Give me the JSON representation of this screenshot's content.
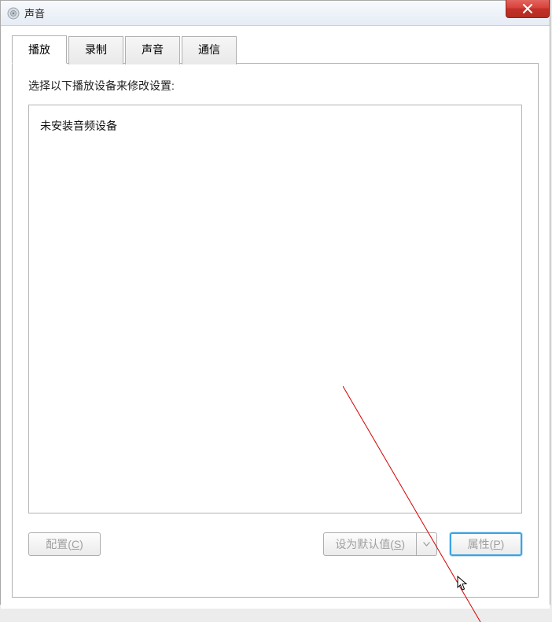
{
  "window": {
    "title": "声音"
  },
  "tabs": [
    {
      "label": "播放",
      "active": true
    },
    {
      "label": "录制",
      "active": false
    },
    {
      "label": "声音",
      "active": false
    },
    {
      "label": "通信",
      "active": false
    }
  ],
  "panel": {
    "instruction": "选择以下播放设备来修改设置:",
    "empty_message": "未安装音频设备"
  },
  "buttons": {
    "configure": {
      "label": "配置(",
      "hotkey": "C",
      "suffix": ")"
    },
    "set_default": {
      "label": "设为默认值(",
      "hotkey": "S",
      "suffix": ")"
    },
    "properties": {
      "label": "属性(",
      "hotkey": "P",
      "suffix": ")"
    }
  }
}
